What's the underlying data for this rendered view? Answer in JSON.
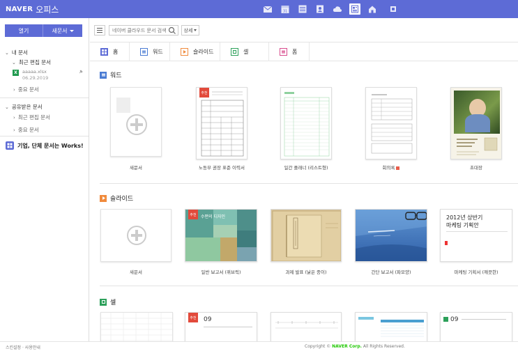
{
  "app": {
    "brand": "NAVER",
    "product": "오피스"
  },
  "top_icons": [
    "mail-icon",
    "calendar-icon",
    "list-icon",
    "contacts-icon",
    "cloud-icon",
    "office-icon",
    "home-icon",
    "extra-icon"
  ],
  "sidebar": {
    "open_label": "열기",
    "new_label": "새문서",
    "my_docs": "내 문서",
    "recent_edited": "최근 편집 문서",
    "recent_file_name": "ааааа.xlsx",
    "recent_file_date": "06.29.2019",
    "important_docs": "중요 문서",
    "shared_docs": "공유받은 문서",
    "shared_recent": "최근 편집 문서",
    "shared_important": "중요 문서",
    "works_promo": "기업, 단체 문서는 Works!"
  },
  "search": {
    "placeholder": "네이버 클라우드 문서 검색",
    "detail_label": "상세"
  },
  "tabs": [
    {
      "label": "홈",
      "icon": "home-icon",
      "color": "#5d6bd6"
    },
    {
      "label": "워드",
      "icon": "word-icon",
      "color": "#4a7bd3"
    },
    {
      "label": "슬라이드",
      "icon": "slide-icon",
      "color": "#f08a3c"
    },
    {
      "label": "셀",
      "icon": "cell-icon",
      "color": "#2ca05a"
    },
    {
      "label": "폼",
      "icon": "form-icon",
      "color": "#d84b8d"
    }
  ],
  "sections": {
    "word": {
      "title": "워드",
      "items": [
        "새문서",
        "노동부 권장 표준 이력서",
        "일간 플래너 (리스트형)",
        "회의록",
        "초대장"
      ]
    },
    "slide": {
      "title": "슬라이드",
      "items": [
        "새문서",
        "일반 보고서 (퀴브릭)",
        "과제 발표 (낡은 종이)",
        "간단 보고서 (파모양)",
        "마케팅 기획서 (깨끗한)"
      ],
      "thumb_texts": {
        "report": "수편의 디자인",
        "marketing_title": "2012년 상반기",
        "marketing_subtitle": "마케팅 기획안"
      }
    },
    "cell": {
      "title": "셀",
      "month_label": "09"
    }
  },
  "footer": {
    "left": "스킨설정 · 사용안내",
    "copyright_prefix": "Copyright ©",
    "copyright_brand": "NAVER Corp.",
    "copyright_suffix": "All Rights Reserved."
  },
  "colors": {
    "accent": "#5d6bd6",
    "word": "#4a7bd3",
    "slide": "#f08a3c",
    "cell": "#2ca05a",
    "form": "#d84b8d"
  }
}
